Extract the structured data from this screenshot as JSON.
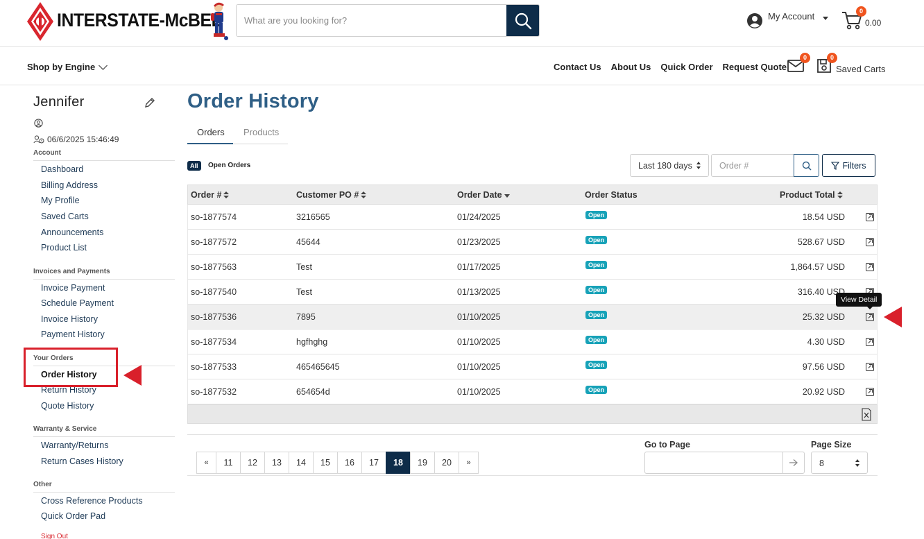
{
  "header": {
    "brand": "INTERSTATE-McBEE",
    "search": {
      "placeholder": "What are you looking for?",
      "value": ""
    },
    "account_label": "My Account",
    "cart_count": "0",
    "cart_total": "0.00"
  },
  "nav": {
    "shop_by_engine": "Shop by Engine",
    "links": [
      "Contact Us",
      "About Us",
      "Quick Order",
      "Request Quote"
    ],
    "mail_count": "0",
    "saved_count": "0",
    "saved_carts": "Saved Carts"
  },
  "sidebar": {
    "user_name": "Jennifer",
    "last_login": "06/6/2025 15:46:49",
    "sections": [
      {
        "title": "Account",
        "items": [
          "Dashboard",
          "Billing Address",
          "My Profile",
          "Saved Carts",
          "Announcements",
          "Product List"
        ]
      },
      {
        "title": "Invoices and Payments",
        "items": [
          "Invoice Payment",
          "Schedule Payment",
          "Invoice History",
          "Payment History"
        ]
      },
      {
        "title": "Your Orders",
        "items": [
          "Order History",
          "Return History",
          "Quote History"
        ]
      },
      {
        "title": "Warranty & Service",
        "items": [
          "Warranty/Returns",
          "Return Cases History"
        ]
      },
      {
        "title": "Other",
        "items": [
          "Cross Reference Products",
          "Quick Order Pad"
        ]
      }
    ],
    "sign_out": "Sign Out"
  },
  "main": {
    "title": "Order History",
    "tabs": [
      "Orders",
      "Products"
    ],
    "filter_chip_all": "All",
    "filter_open_orders": "Open Orders",
    "date_range": "Last 180 days",
    "order_search_placeholder": "Order #",
    "filters_label": "Filters",
    "columns": [
      "Order #",
      "Customer PO #",
      "Order Date",
      "Order Status",
      "Product Total"
    ],
    "rows": [
      {
        "order": "so-1877574",
        "po": "3216565",
        "date": "01/24/2025",
        "status": "Open",
        "total": "18.54 USD"
      },
      {
        "order": "so-1877572",
        "po": "45644",
        "date": "01/23/2025",
        "status": "Open",
        "total": "528.67 USD"
      },
      {
        "order": "so-1877563",
        "po": "Test",
        "date": "01/17/2025",
        "status": "Open",
        "total": "1,864.57 USD"
      },
      {
        "order": "so-1877540",
        "po": "Test",
        "date": "01/13/2025",
        "status": "Open",
        "total": "316.40 USD"
      },
      {
        "order": "so-1877536",
        "po": "7895",
        "date": "01/10/2025",
        "status": "Open",
        "total": "25.32 USD"
      },
      {
        "order": "so-1877534",
        "po": "hgfhghg",
        "date": "01/10/2025",
        "status": "Open",
        "total": "4.30 USD"
      },
      {
        "order": "so-1877533",
        "po": "465465645",
        "date": "01/10/2025",
        "status": "Open",
        "total": "97.56 USD"
      },
      {
        "order": "so-1877532",
        "po": "654654d",
        "date": "01/10/2025",
        "status": "Open",
        "total": "20.92 USD"
      }
    ],
    "tooltip": "View Detail",
    "pagination": {
      "first": "«",
      "pages": [
        "11",
        "12",
        "13",
        "14",
        "15",
        "16",
        "17",
        "18",
        "19",
        "20"
      ],
      "current": "18",
      "last": "»"
    },
    "go_to_page_label": "Go to Page",
    "page_size_label": "Page Size",
    "page_size": "8",
    "colors": {
      "brand_navy": "#0e2c49",
      "title_blue": "#2f5f86",
      "status_teal": "#17a2b8",
      "annotation_red": "#d9202b",
      "badge_orange": "#f0541e"
    }
  }
}
